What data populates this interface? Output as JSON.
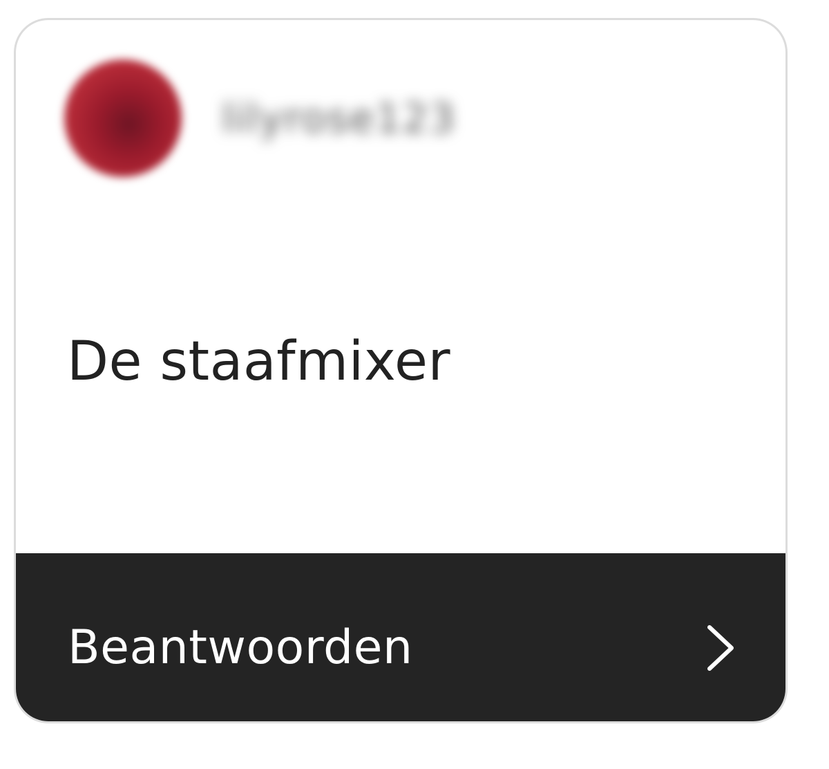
{
  "header": {
    "avatar_icon": "profile-avatar",
    "username": "lilyrose123"
  },
  "question": {
    "text": "De staafmixer"
  },
  "answer_bar": {
    "label": "Beantwoorden",
    "icon": "chevron-right-icon",
    "background_color": "#242424",
    "text_color": "#ffffff"
  }
}
